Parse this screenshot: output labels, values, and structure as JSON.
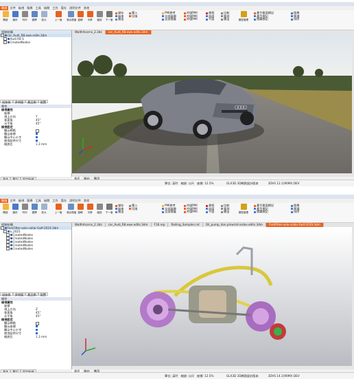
{
  "windows": [
    {
      "id": "win1",
      "menu": [
        "開啟",
        "文件",
        "檢視",
        "搜尋",
        "工具",
        "檢閱",
        "工作",
        "暫存",
        "說明文件",
        "其他"
      ],
      "ribbon": {
        "big": [
          "開啟",
          "儲存",
          "列印",
          "選擇",
          "放大",
          "旋轉",
          "平移",
          "縮放",
          "上一個",
          "下一個",
          "適合視窗"
        ],
        "small_a": [
          "儲存",
          "檢查",
          "匯出",
          "匯入",
          "切換"
        ],
        "small_b": [
          "PMI參考",
          "全部展開",
          "全部摺疊"
        ],
        "small_c": [
          "符號PMI",
          "符號PMI",
          "符號PMI"
        ],
        "small_d": [
          "邊框",
          "剖面",
          "平面"
        ],
        "small_e": [
          "比較",
          "量測",
          "匯出"
        ],
        "small_f": [
          "產生截面標記",
          "產生標記",
          "隱藏標記"
        ],
        "small_g": [
          "搜尋",
          "篩選",
          "排序"
        ],
        "big2": [
          "模型管理",
          "報表"
        ],
        "groups": [
          "剪貼",
          "檢閱",
          "控制",
          "選擇模式",
          "量測",
          "截面/標記",
          "細節"
        ]
      },
      "sidebar": {
        "assembly_title": "組裝結構",
        "tree": [
          "car_Audi_R8.ewe.edits.3dm",
          "Audi R8 S",
          "CreatedNodes"
        ],
        "tabs": [
          "組裝樹",
          "多視窗",
          "產品樹",
          "配置"
        ],
        "props_title": "屬性",
        "view_group": "檢視屬性",
        "view_sub": "座標",
        "props": [
          {
            "k": "視上方向",
            "v": "Y"
          },
          {
            "k": "垂直角",
            "v": "45°"
          },
          {
            "k": "水平角",
            "v": "45°"
          }
        ],
        "display_group": "檢視設定",
        "checks": [
          "顯示網格",
          "顯示座標",
          "顯示中心十字",
          "使用配件尺寸"
        ],
        "scale_k": "縮放比",
        "scale_v": "1.3 mm",
        "bottom_tabs": [
          "屬性",
          "筆記",
          "設定檢視"
        ]
      },
      "doctabs": [
        "WalthAcorns_2.3dz",
        "car_Audi_R8.ewe.edits.3dm"
      ],
      "active_doctab": 1,
      "bottom_tabs": [
        "資訊",
        "輸出",
        "應用"
      ],
      "status": {
        "left": [
          "單位: 英吋",
          "縮放: 公尺",
          "座標: 12.5%"
        ],
        "right": [
          "GLX3D 3D網頁設計版本",
          "3DVS 12.1(9099) DEV"
        ]
      }
    },
    {
      "id": "win2",
      "menu": [
        "開啟",
        "文件",
        "檢視",
        "搜尋",
        "工具",
        "檢閱",
        "工作",
        "暫存",
        "說明文件",
        "其他"
      ],
      "ribbon": {
        "big": [
          "開啟",
          "儲存",
          "列印",
          "選擇",
          "放大",
          "旋轉",
          "平移",
          "縮放",
          "上一個",
          "下一個",
          "適合視窗"
        ],
        "small_a": [
          "儲存",
          "檢查",
          "匯出",
          "匯入",
          "切換"
        ],
        "small_b": [
          "PMI參考",
          "全部展開",
          "全部摺疊"
        ],
        "small_c": [
          "符號PMI",
          "符號PMI",
          "符號PMI"
        ],
        "small_d": [
          "邊框",
          "剖面",
          "平面"
        ],
        "small_e": [
          "比較",
          "量測",
          "匯出"
        ],
        "small_f": [
          "產生截面標記",
          "產生標記",
          "隱藏標記"
        ],
        "small_g": [
          "搜尋",
          "篩選",
          "排序"
        ],
        "big2": [
          "模型管理",
          "報表"
        ],
        "groups": [
          "剪貼",
          "檢閱",
          "控制",
          "選擇模式",
          "量測",
          "截面/標記",
          "細節"
        ]
      },
      "sidebar": {
        "assembly_title": "組裝結構",
        "tree": [
          "ForkFilter-axle-collar-Golf-2019.3dm",
          "a_2021",
          "CreatedNodes",
          "CreatedNodes",
          "CreatedNodes",
          "CreatedNodes",
          "CreatedNodes"
        ],
        "tabs": [
          "組裝樹",
          "多視窗",
          "產品樹",
          "配置"
        ],
        "props_title": "屬性",
        "view_group": "檢視屬性",
        "view_sub": "座標",
        "props": [
          {
            "k": "視上方向",
            "v": "Z"
          },
          {
            "k": "垂直角",
            "v": "45°"
          },
          {
            "k": "水平角",
            "v": "45°"
          }
        ],
        "display_group": "檢視設定",
        "checks": [
          "顯示網格",
          "顯示座標",
          "顯示中心十字",
          "使用配件尺寸"
        ],
        "scale_k": "縮放比",
        "scale_v": "1.3 mm",
        "bottom_tabs": [
          "屬性",
          "筆記",
          "設定檢視"
        ]
      },
      "doctabs": [
        "WalthAcorns_2.3dz",
        "car_Audi_R8.ewe.edits.3dm",
        "F16.rep",
        "Railing_Samples.rvt",
        "Oil_pump_4on.pinwrist-ardse.edits.3dm",
        "ForkFilter-axle-collar-Golf-2019.3dm"
      ],
      "active_doctab": 5,
      "bottom_tabs": [
        "資訊",
        "輸出",
        "應用"
      ],
      "status": {
        "left": [
          "單位: 英吋",
          "縮放: 公尺",
          "座標: 12.5%"
        ],
        "right": [
          "GLX3D 3D網頁設計版本",
          "3DVS 14.1(9099) DEV"
        ]
      }
    }
  ],
  "colors": {
    "accent": "#e8621e",
    "ribbon_bg": "#f7f7f7",
    "panel_head": "#dfe6ef"
  }
}
